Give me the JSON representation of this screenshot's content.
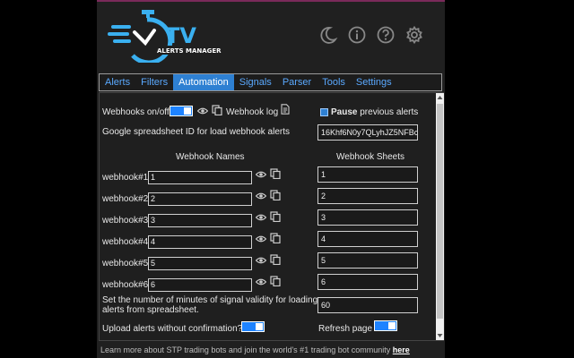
{
  "app": {
    "logo_letters": "TV",
    "logo_caption": "ALERTS MANAGER"
  },
  "header": {
    "icons": [
      "moon-icon",
      "info-icon",
      "help-icon",
      "gear-icon"
    ]
  },
  "tabs": [
    {
      "label": "Alerts",
      "active": false
    },
    {
      "label": "Filters",
      "active": false
    },
    {
      "label": "Automation",
      "active": true
    },
    {
      "label": "Signals",
      "active": false
    },
    {
      "label": "Parser",
      "active": false
    },
    {
      "label": "Tools",
      "active": false
    },
    {
      "label": "Settings",
      "active": false
    }
  ],
  "automation": {
    "webhooks_label": "Webhooks on/off",
    "webhooks_on": true,
    "webhook_log_label": "Webhook log",
    "pause_bold": "Pause",
    "pause_rest": "previous alerts",
    "pause_checked": true,
    "spreadsheet_label": "Google spreadsheet ID for load webhook alerts",
    "spreadsheet_id": "16Khf6N0y7QLyhJZ5NFBc",
    "names_header": "Webhook Names",
    "sheets_header": "Webhook Sheets",
    "rows": [
      {
        "label": "webhook#1",
        "name": "1",
        "sheet": "1"
      },
      {
        "label": "webhook#2",
        "name": "2",
        "sheet": "2"
      },
      {
        "label": "webhook#3",
        "name": "3",
        "sheet": "3"
      },
      {
        "label": "webhook#4",
        "name": "4",
        "sheet": "4"
      },
      {
        "label": "webhook#5",
        "name": "5",
        "sheet": "5"
      },
      {
        "label": "webhook#6",
        "name": "6",
        "sheet": "6"
      }
    ],
    "validity_label_1": "Set the number of minutes of signal validity for loading",
    "validity_label_2": "alerts from spreadsheet.",
    "validity_value": "60",
    "upload_label": "Upload alerts without confirmation?",
    "upload_on": true,
    "refresh_label": "Refresh page",
    "refresh_on": true
  },
  "footer": {
    "text": "Learn more about STP trading bots and join the world's #1 trading bot community",
    "link": "here"
  },
  "colors": {
    "accent": "#2e80d2",
    "tab_link": "#5aa9ff",
    "toggle_on": "#1e83ff",
    "logo_blue": "#3ab0f0"
  }
}
